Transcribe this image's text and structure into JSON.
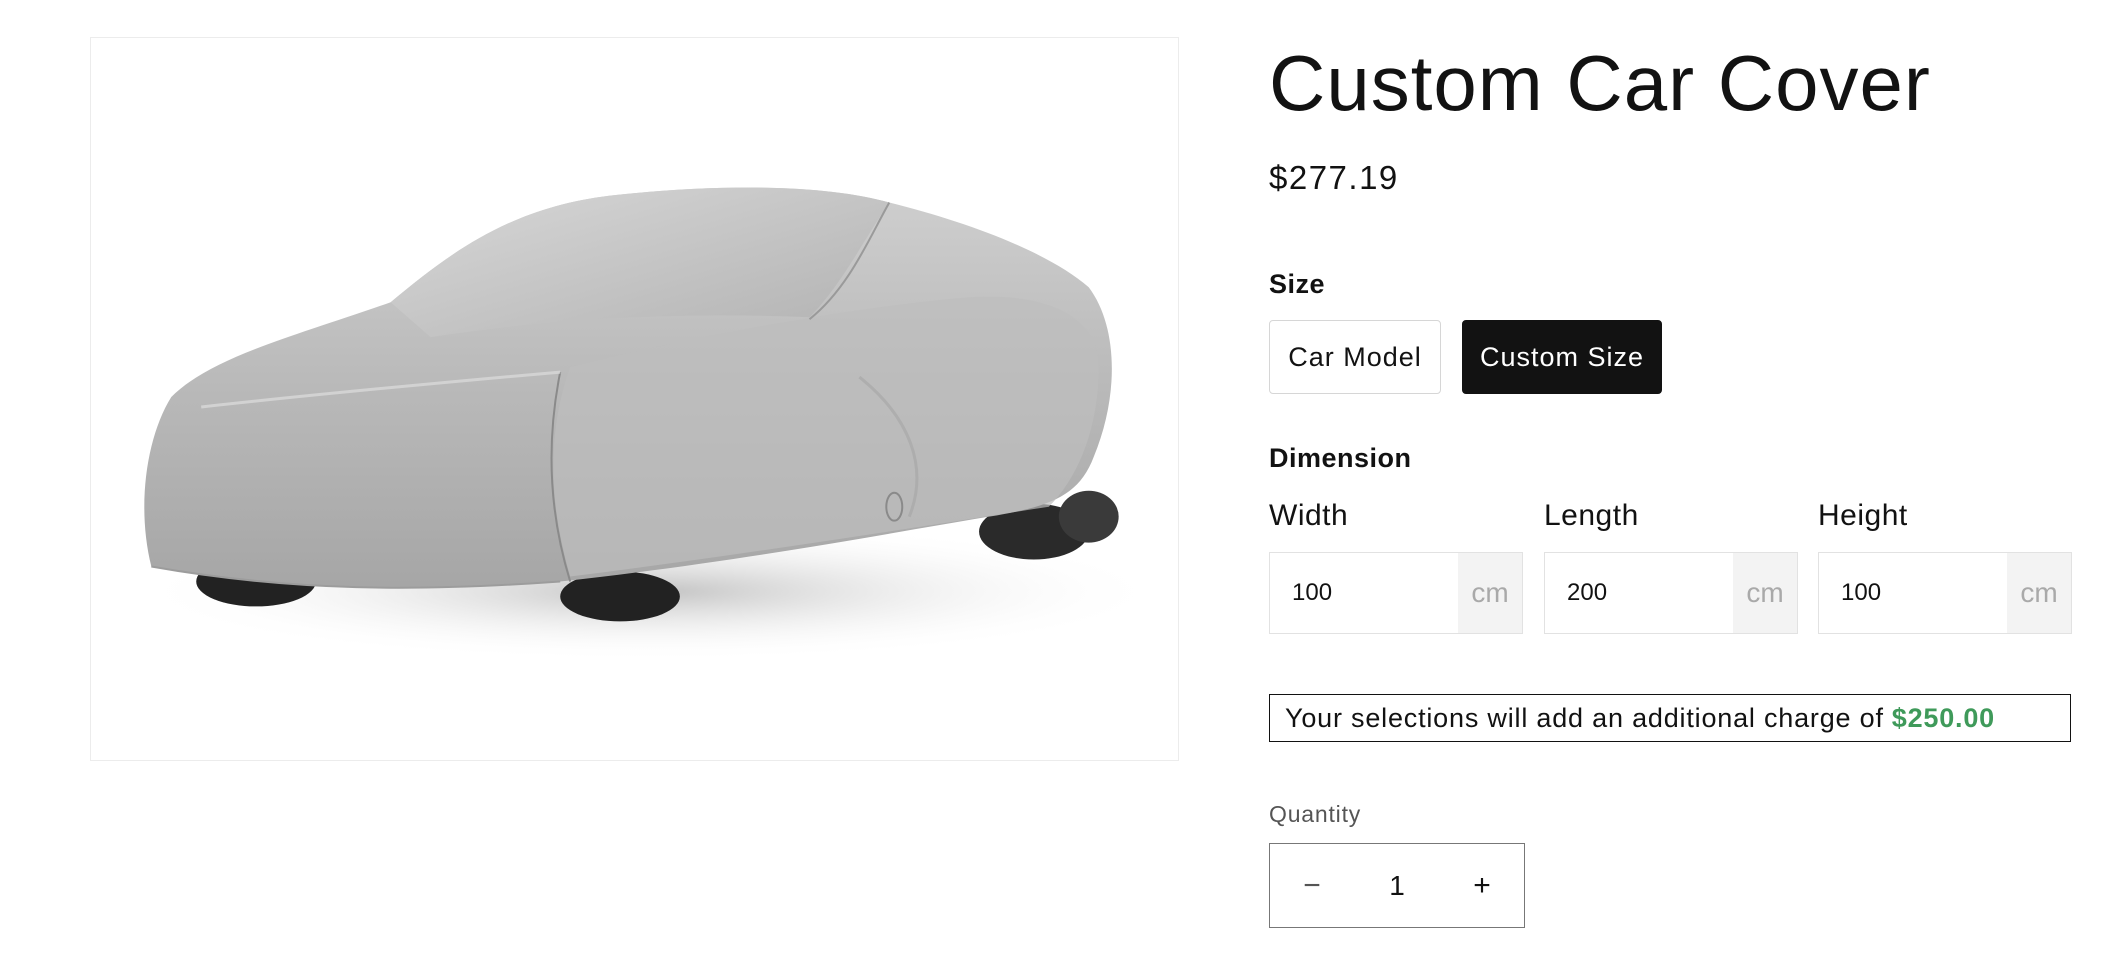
{
  "product": {
    "title": "Custom Car Cover",
    "price": "$277.19"
  },
  "size": {
    "label": "Size",
    "options": [
      {
        "label": "Car Model",
        "selected": false
      },
      {
        "label": "Custom Size",
        "selected": true
      }
    ]
  },
  "dimension": {
    "label": "Dimension",
    "fields": [
      {
        "label": "Width",
        "value": "100",
        "unit": "cm"
      },
      {
        "label": "Length",
        "value": "200",
        "unit": "cm"
      },
      {
        "label": "Height",
        "value": "100",
        "unit": "cm"
      }
    ]
  },
  "charge": {
    "text": "Your selections will add an additional charge of",
    "amount": "$250.00",
    "amount_color": "#3f9a5a"
  },
  "quantity": {
    "label": "Quantity",
    "value": "1",
    "decrement_icon": "minus-icon",
    "increment_icon": "plus-icon"
  },
  "colors": {
    "selected_bg": "#121212",
    "text": "#121212",
    "unit_bg": "#f3f3f3"
  }
}
